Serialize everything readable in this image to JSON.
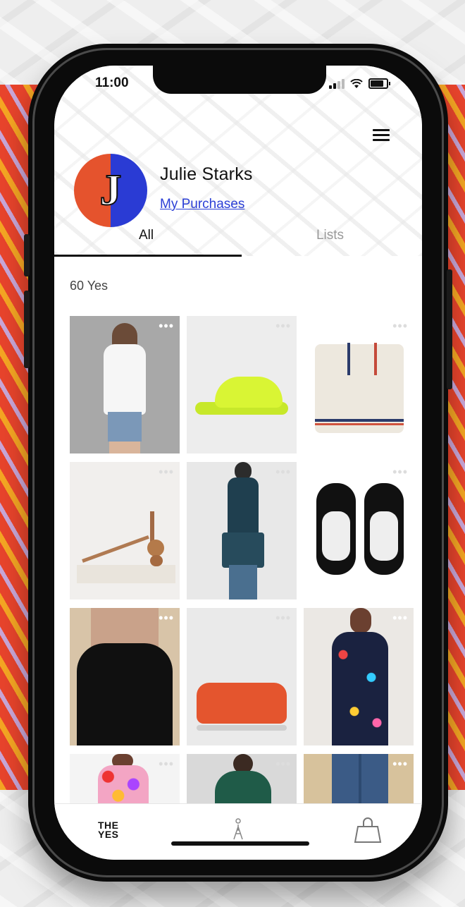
{
  "status_bar": {
    "time": "11:00"
  },
  "profile": {
    "name": "Julie Starks",
    "purchases_link": "My Purchases",
    "avatar_letter": "J",
    "avatar_colors": [
      "#e5532d",
      "#2a3bd4"
    ]
  },
  "tabs": [
    {
      "label": "All",
      "active": true
    },
    {
      "label": "Lists",
      "active": false
    }
  ],
  "count_label": "60 Yes",
  "items": [
    {
      "name": "white-lace-blouse-denim-shorts",
      "bg": "#a9a9a9"
    },
    {
      "name": "neon-yellow-sneaker",
      "bg": "#ededed"
    },
    {
      "name": "cream-striped-cardigan",
      "bg": "#ffffff"
    },
    {
      "name": "tan-sculptural-heel-sandal",
      "bg": "#f1efed"
    },
    {
      "name": "teal-turtleneck-dress",
      "bg": "#e8e8e8"
    },
    {
      "name": "black-white-sneakers",
      "bg": "#ffffff"
    },
    {
      "name": "black-sweetheart-top",
      "bg": "#d8c4a8"
    },
    {
      "name": "orange-leather-clutch",
      "bg": "#eaeaea"
    },
    {
      "name": "printed-navy-blouse",
      "bg": "#ebe8e4"
    },
    {
      "name": "floral-print-top",
      "bg": "#f4f4f4"
    },
    {
      "name": "green-pleated-top",
      "bg": "#d9d9d9"
    },
    {
      "name": "blue-jeans",
      "bg": "#d7c29c"
    }
  ],
  "more_glyph": "•••",
  "bottom_nav": {
    "logo_line1": "THE",
    "logo_line2": "YES",
    "figure_icon": "person-figure-icon",
    "bag_icon": "shopping-bag-icon"
  },
  "colors": {
    "link": "#2b3fd6",
    "accent_orange": "#e8442c"
  }
}
